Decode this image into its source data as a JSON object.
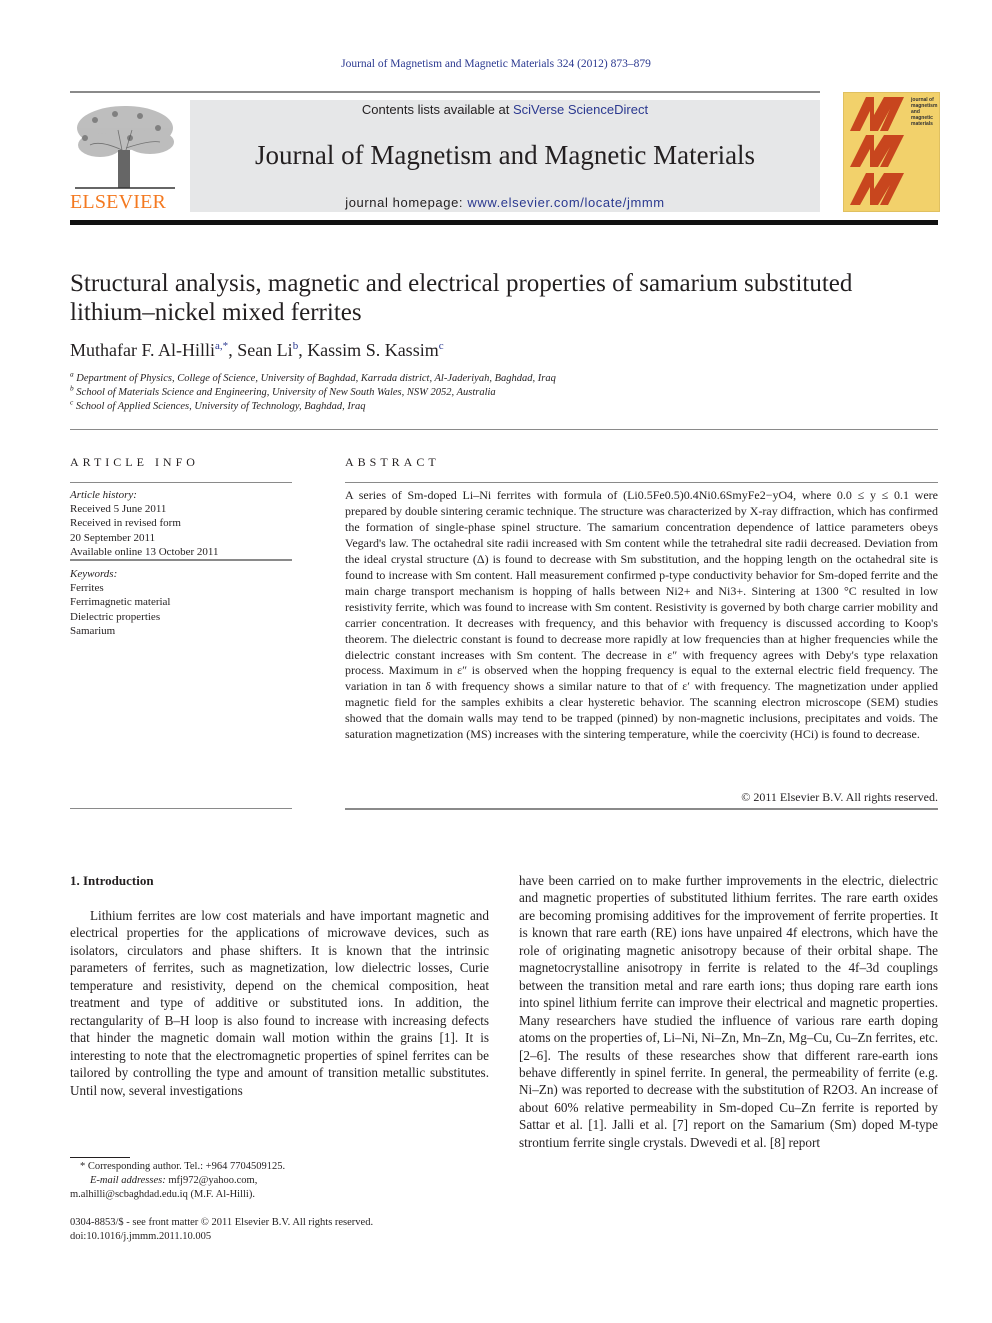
{
  "header": {
    "journal_ref": "Journal of Magnetism and Magnetic Materials 324 (2012) 873–879",
    "contents_prefix": "Contents lists available at ",
    "contents_link": "SciVerse ScienceDirect",
    "journal_title": "Journal of Magnetism and Magnetic Materials",
    "homepage_prefix": "journal homepage: ",
    "homepage_link": "www.elsevier.com/locate/jmmm",
    "publisher_logo_text": "ELSEVIER",
    "cover_text": "journal of magnetism and magnetic materials",
    "colors": {
      "link": "#2b3990",
      "elsevier_orange": "#f47920",
      "banner_gray": "#e6e7e8",
      "cover_yellow": "#f2d16b",
      "cover_red": "#c8461e"
    }
  },
  "article": {
    "title": "Structural analysis, magnetic and electrical properties of samarium substituted lithium–nickel mixed ferrites",
    "authors": [
      {
        "name": "Muthafar F. Al-Hilli",
        "sup": "a,*"
      },
      {
        "name": "Sean Li",
        "sup": "b"
      },
      {
        "name": "Kassim S. Kassim",
        "sup": "c"
      }
    ],
    "affiliations": [
      {
        "label": "a",
        "text": "Department of Physics, College of Science, University of Baghdad, Karrada district, Al-Jaderiyah, Baghdad, Iraq"
      },
      {
        "label": "b",
        "text": "School of Materials Science and Engineering, University of New South Wales, NSW 2052, Australia"
      },
      {
        "label": "c",
        "text": "School of Applied Sciences, University of Technology, Baghdad, Iraq"
      }
    ]
  },
  "article_info": {
    "label": "ARTICLE INFO",
    "history_label": "Article history:",
    "history": [
      "Received 5 June 2011",
      "Received in revised form",
      "20 September 2011",
      "Available online 13 October 2011"
    ],
    "keywords_label": "Keywords:",
    "keywords": [
      "Ferrites",
      "Ferrimagnetic material",
      "Dielectric properties",
      "Samarium"
    ]
  },
  "abstract": {
    "label": "ABSTRACT",
    "text_1": "A series of Sm-doped Li–Ni ferrites with formula of (Li0.5Fe0.5)0.4Ni0.6SmyFe2−yO4, where 0.0 ≤ y ≤ 0.1 were prepared by double sintering ceramic technique. The structure was characterized by X-ray diffraction, which has confirmed the formation of single-phase spinel structure. The samarium concentration dependence of lattice parameters obeys Vegard's law. The octahedral site radii increased with Sm content while the tetrahedral site radii decreased. Deviation from the ideal crystal structure (Δ) is found to decrease with Sm substitution, and the hopping length on the octahedral site is found to increase with Sm content. Hall measurement confirmed p-type conductivity behavior for Sm-doped ferrite and the main charge transport mechanism is hopping of halls between Ni2+ and Ni3+. Sintering at 1300 °C resulted in low resistivity ferrite, which was found to increase with Sm content. Resistivity is governed by both charge carrier mobility and carrier concentration. It decreases with frequency, and this behavior with frequency is discussed according to Koop's theorem. The dielectric constant is found to decrease more rapidly at low frequencies than at higher frequencies while the dielectric constant increases with Sm content. The decrease in ε″ with frequency agrees with Deby's type relaxation process. Maximum in ε″ is observed when the hopping frequency is equal to the external electric field frequency. The variation in tan δ with frequency shows a similar nature to that of ε′ with frequency. The magnetization under applied magnetic field for the samples exhibits a clear hysteretic behavior. The scanning electron microscope (SEM) studies showed that the domain walls may tend to be trapped (pinned) by non-magnetic inclusions, precipitates and voids. The saturation magnetization (MS) increases with the sintering temperature, while the coercivity (HCi) is found to decrease.",
    "copyright": "© 2011 Elsevier B.V. All rights reserved."
  },
  "introduction": {
    "heading": "1.  Introduction",
    "left_column": "Lithium ferrites are low cost materials and have important magnetic and electrical properties for the applications of microwave devices, such as isolators, circulators and phase shifters. It is known that the intrinsic parameters of ferrites, such as magnetization, low dielectric losses, Curie temperature and resistivity, depend on the chemical composition, heat treatment and type of additive or substituted ions. In addition, the rectangularity of B–H loop is also found to increase with increasing defects that hinder the magnetic domain wall motion within the grains [1]. It is interesting to note that the electromagnetic properties of spinel ferrites can be tailored by controlling the type and amount of transition metallic substitutes. Until now, several investigations",
    "right_column": "have been carried on to make further improvements in the electric, dielectric and magnetic properties of substituted lithium ferrites. The rare earth oxides are becoming promising additives for the improvement of ferrite properties. It is known that rare earth (RE) ions have unpaired 4f electrons, which have the role of originating magnetic anisotropy because of their orbital shape. The magnetocrystalline anisotropy in ferrite is related to the 4f–3d couplings between the transition metal and rare earth ions; thus doping rare earth ions into spinel lithium ferrite can improve their electrical and magnetic properties. Many researchers have studied the influence of various rare earth doping atoms on the properties of, Li–Ni, Ni–Zn, Mn–Zn, Mg–Cu, Cu–Zn ferrites, etc. [2–6]. The results of these researches show that different rare-earth ions behave differently in spinel ferrite. In general, the permeability of ferrite (e.g. Ni–Zn) was reported to decrease with the substitution of R2O3. An increase of about 60% relative permeability in Sm-doped Cu–Zn ferrite is reported by Sattar et al. [1]. Jalli et al. [7] report on the Samarium (Sm) doped M-type strontium ferrite single crystals. Dwevedi et al. [8] report"
  },
  "footnotes": {
    "corresponding": "* Corresponding author. Tel.: +964 7704509125.",
    "email_label": "E-mail addresses:",
    "email_1": "mfj972@yahoo.com,",
    "email_2": "m.alhilli@scbaghdad.edu.iq (M.F. Al-Hilli).",
    "front_matter": "0304-8853/$ - see front matter © 2011 Elsevier B.V. All rights reserved.",
    "doi": "doi:10.1016/j.jmmm.2011.10.005"
  }
}
